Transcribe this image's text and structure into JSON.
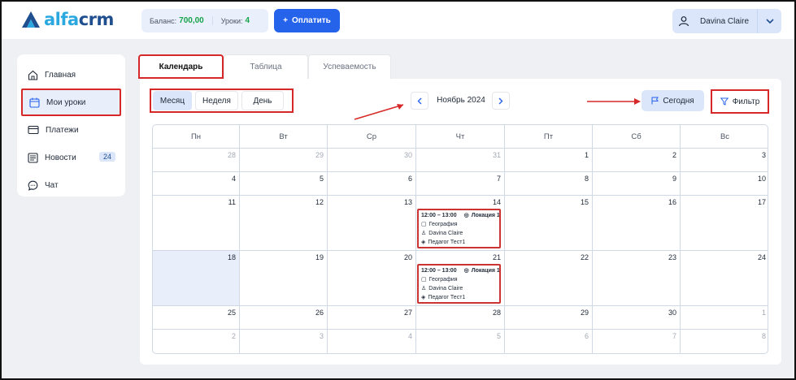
{
  "app": {
    "logo_prefix": "alfa",
    "logo_suffix": "crm"
  },
  "header": {
    "balance_label": "Баланс:",
    "balance_value": "700,00",
    "lessons_label": "Уроки:",
    "lessons_value": "4",
    "pay_button": "Оплатить",
    "user_name": "Davina Claire"
  },
  "sidebar": {
    "items": [
      {
        "label": "Главная",
        "icon": "home-icon"
      },
      {
        "label": "Мои уроки",
        "icon": "calendar-icon"
      },
      {
        "label": "Платежи",
        "icon": "card-icon"
      },
      {
        "label": "Новости",
        "icon": "news-icon",
        "badge": "24"
      },
      {
        "label": "Чат",
        "icon": "chat-icon"
      }
    ]
  },
  "tabs": [
    "Календарь",
    "Таблица",
    "Успеваемость"
  ],
  "toolbar": {
    "views": [
      "Месяц",
      "Неделя",
      "День"
    ],
    "month_label": "Ноябрь 2024",
    "today_button": "Сегодня",
    "filter_button": "Фильтр"
  },
  "calendar": {
    "weekdays": [
      "Пн",
      "Вт",
      "Ср",
      "Чт",
      "Пт",
      "Сб",
      "Вс"
    ],
    "weeks": [
      [
        "28",
        "29",
        "30",
        "31",
        "1",
        "2",
        "3"
      ],
      [
        "4",
        "5",
        "6",
        "7",
        "8",
        "9",
        "10"
      ],
      [
        "11",
        "12",
        "13",
        "14",
        "15",
        "16",
        "17"
      ],
      [
        "18",
        "19",
        "20",
        "21",
        "22",
        "23",
        "24"
      ],
      [
        "25",
        "26",
        "27",
        "28",
        "29",
        "30",
        "1"
      ],
      [
        "2",
        "3",
        "4",
        "5",
        "6",
        "7",
        "8"
      ]
    ],
    "events": [
      {
        "time": "12:00 – 13:00",
        "location": "Локация 1",
        "subject": "География",
        "student": "Davina Claire",
        "teacher": "Педагог Тест1"
      },
      {
        "time": "12:00 – 13:00",
        "location": "Локация 1",
        "subject": "География",
        "student": "Davina Claire",
        "teacher": "Педагог Тест1"
      }
    ]
  },
  "colors": {
    "accent": "#2563eb",
    "highlight": "#d62828",
    "today_bg": "#e9eefb"
  }
}
